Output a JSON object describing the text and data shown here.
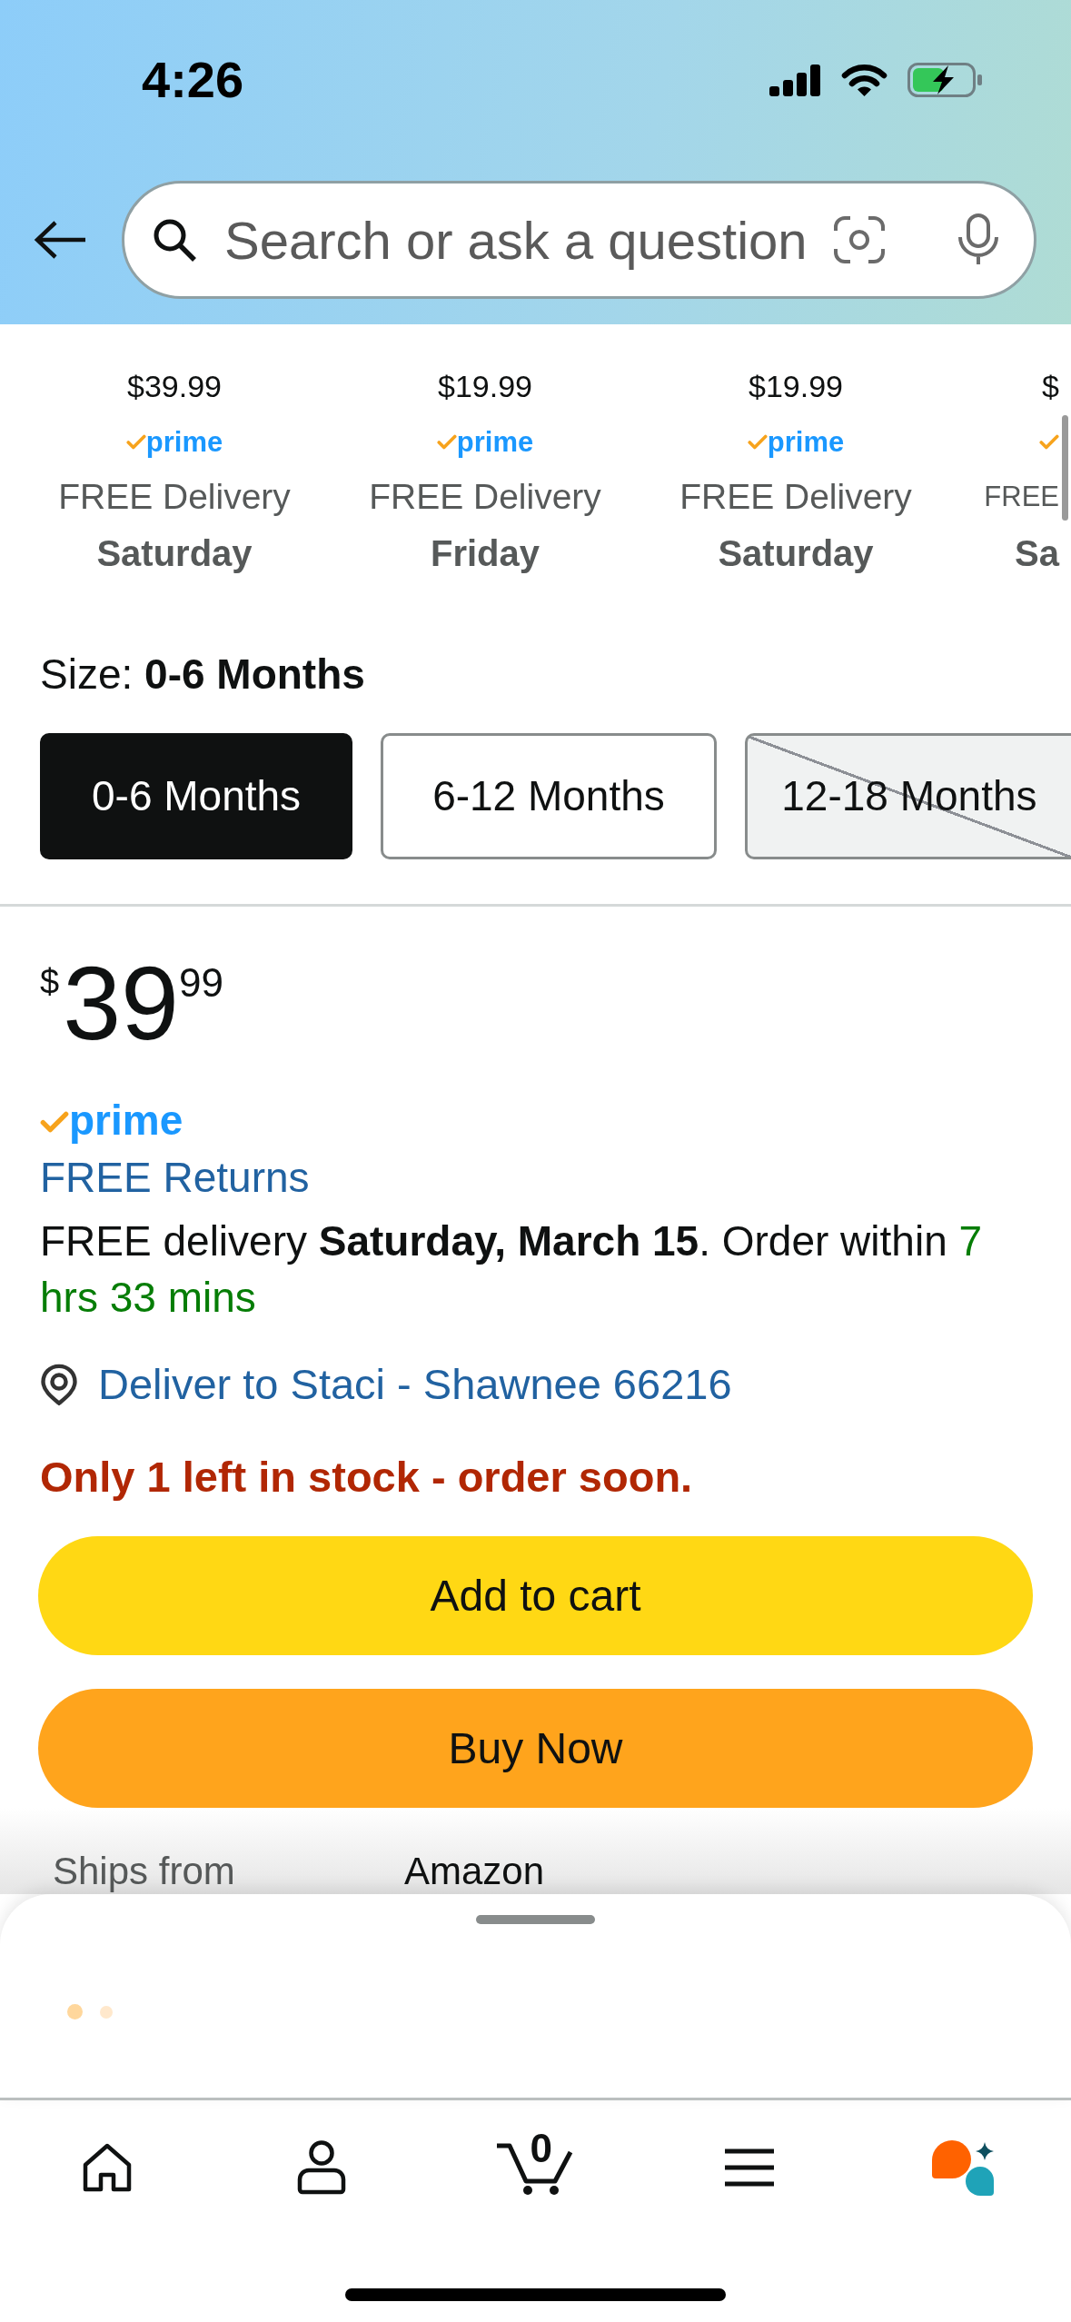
{
  "status_bar": {
    "time": "4:26"
  },
  "search": {
    "placeholder": "Search or ask a question"
  },
  "variants": [
    {
      "kind": "full",
      "price": "$39.99",
      "prime": "prime",
      "delivery": "FREE Delivery",
      "day": "Saturday"
    },
    {
      "kind": "full",
      "price": "$19.99",
      "prime": "prime",
      "delivery": "FREE Delivery",
      "day": "Friday"
    },
    {
      "kind": "full",
      "price": "$19.99",
      "prime": "prime",
      "delivery": "FREE Delivery",
      "day": "Saturday"
    },
    {
      "kind": "partial",
      "price": "$",
      "delivery": "FREE",
      "day": "Sa"
    }
  ],
  "size": {
    "label": "Size:",
    "value": "0-6 Months",
    "options": [
      {
        "label": "0-6 Months",
        "selected": true,
        "available": true
      },
      {
        "label": "6-12 Months",
        "selected": false,
        "available": true
      },
      {
        "label": "12-18 Months",
        "selected": false,
        "available": false
      }
    ]
  },
  "price": {
    "currency": "$",
    "whole": "39",
    "fraction": "99"
  },
  "prime": "prime",
  "returns_link": "FREE Returns",
  "delivery": {
    "text": "FREE delivery **Saturday, March 15**. Order within",
    "countdown": "7 hrs 33 mins"
  },
  "location": "Deliver to Staci - Shawnee 66216",
  "stock": "Only 1 left in stock - order soon.",
  "actions": [
    {
      "kind": "add_to_cart",
      "label": "Add to cart"
    },
    {
      "kind": "buy_now",
      "label": "Buy Now"
    }
  ],
  "ships_from": {
    "label": "Ships from",
    "value": "Amazon"
  },
  "nav": [
    {
      "kind": "home"
    },
    {
      "kind": "account"
    },
    {
      "kind": "cart",
      "badge": "0"
    },
    {
      "kind": "menu"
    },
    {
      "kind": "assistant"
    }
  ]
}
